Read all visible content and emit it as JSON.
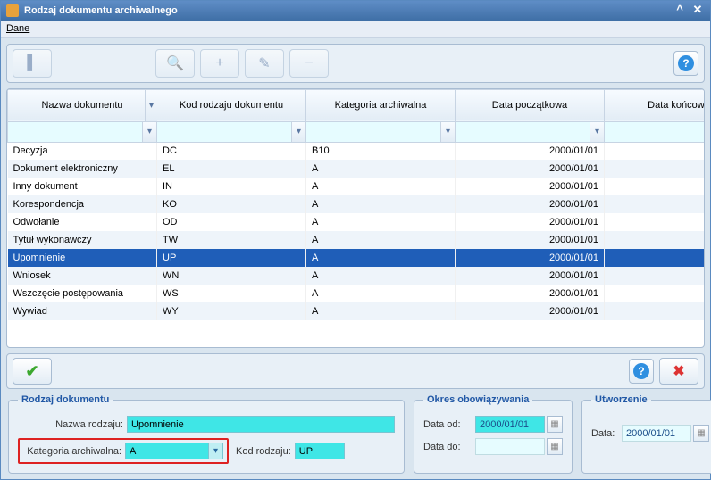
{
  "window": {
    "title": "Rodzaj dokumentu archiwalnego"
  },
  "menu": {
    "dane": "Dane"
  },
  "table": {
    "headers": {
      "name": "Nazwa dokumentu",
      "kod": "Kod rodzaju dokumentu",
      "kat": "Kategoria archiwalna",
      "dp": "Data początkowa",
      "dk": "Data końcowa"
    },
    "rows": [
      {
        "name": "Decyzja",
        "kod": "DC",
        "kat": "B10",
        "dp": "2000/01/01",
        "dk": ""
      },
      {
        "name": "Dokument elektroniczny",
        "kod": "EL",
        "kat": "A",
        "dp": "2000/01/01",
        "dk": ""
      },
      {
        "name": "Inny dokument",
        "kod": "IN",
        "kat": "A",
        "dp": "2000/01/01",
        "dk": ""
      },
      {
        "name": "Korespondencja",
        "kod": "KO",
        "kat": "A",
        "dp": "2000/01/01",
        "dk": ""
      },
      {
        "name": "Odwołanie",
        "kod": "OD",
        "kat": "A",
        "dp": "2000/01/01",
        "dk": ""
      },
      {
        "name": "Tytuł wykonawczy",
        "kod": "TW",
        "kat": "A",
        "dp": "2000/01/01",
        "dk": ""
      },
      {
        "name": "Upomnienie",
        "kod": "UP",
        "kat": "A",
        "dp": "2000/01/01",
        "dk": "",
        "selected": true
      },
      {
        "name": "Wniosek",
        "kod": "WN",
        "kat": "A",
        "dp": "2000/01/01",
        "dk": ""
      },
      {
        "name": "Wszczęcie postępowania",
        "kod": "WS",
        "kat": "A",
        "dp": "2000/01/01",
        "dk": ""
      },
      {
        "name": "Wywiad",
        "kod": "WY",
        "kat": "A",
        "dp": "2000/01/01",
        "dk": ""
      }
    ]
  },
  "rodzaj": {
    "legend": "Rodzaj dokumentu",
    "nazwa_label": "Nazwa rodzaju:",
    "nazwa_value": "Upomnienie",
    "kat_label": "Kategoria archiwalna:",
    "kat_value": "A",
    "kod_label": "Kod rodzaju:",
    "kod_value": "UP"
  },
  "okres": {
    "legend": "Okres obowiązywania",
    "od_label": "Data od:",
    "od_value": "2000/01/01",
    "do_label": "Data do:",
    "do_value": ""
  },
  "utw": {
    "legend": "Utworzenie",
    "data_label": "Data:",
    "data_value": "2000/01/01"
  }
}
